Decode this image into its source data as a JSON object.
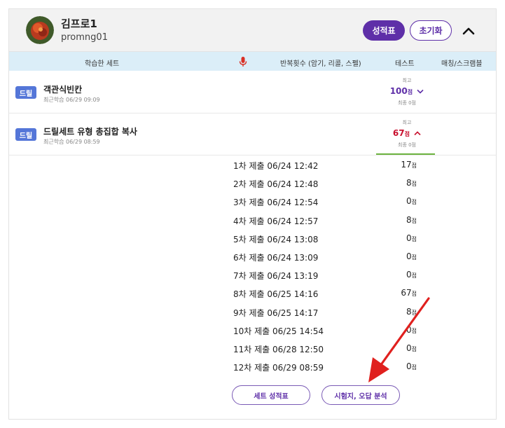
{
  "user": {
    "name": "김프로1",
    "id": "promng01"
  },
  "buttons": {
    "report": "성적표",
    "reset": "초기화",
    "set_report": "세트 성적표",
    "exam_analysis": "시험지, 오답 분석"
  },
  "columns": {
    "set": "학습한 세트",
    "repeat": "반복횟수 (암기, 리콜, 스펠)",
    "test": "테스트",
    "match": "매칭/스크램블"
  },
  "icons": {
    "mic": "microphone-icon",
    "collapse": "chevron-up-icon",
    "expand": "chevron-down-icon",
    "mic_color": "#d93025"
  },
  "sets": [
    {
      "badge": "드릴",
      "title": "객관식빈칸",
      "date": "최근학습 06/29 09:09",
      "best_label": "최고",
      "score": "100",
      "score_unit": "점",
      "final": "최종 0점",
      "color": "#5e2fa8"
    },
    {
      "badge": "드릴",
      "title": "드릴세트 유형 총집합 복사",
      "date": "최근학습 06/29 08:59",
      "best_label": "최고",
      "score": "67",
      "score_unit": "점",
      "final": "최종 0점",
      "color": "#c8102e"
    }
  ],
  "attempts": [
    {
      "label": "1차 제출 06/24 12:42",
      "score": "17",
      "unit": "점"
    },
    {
      "label": "2차 제출 06/24 12:48",
      "score": "8",
      "unit": "점"
    },
    {
      "label": "3차 제출 06/24 12:54",
      "score": "0",
      "unit": "점"
    },
    {
      "label": "4차 제출 06/24 12:57",
      "score": "8",
      "unit": "점"
    },
    {
      "label": "5차 제출 06/24 13:08",
      "score": "0",
      "unit": "점"
    },
    {
      "label": "6차 제출 06/24 13:09",
      "score": "0",
      "unit": "점"
    },
    {
      "label": "7차 제출 06/24 13:19",
      "score": "0",
      "unit": "점"
    },
    {
      "label": "8차 제출 06/25 14:16",
      "score": "67",
      "unit": "점"
    },
    {
      "label": "9차 제출 06/25 14:17",
      "score": "8",
      "unit": "점"
    },
    {
      "label": "10차 제출 06/25 14:54",
      "score": "0",
      "unit": "점"
    },
    {
      "label": "11차 제출 06/28 12:50",
      "score": "0",
      "unit": "점"
    },
    {
      "label": "12차 제출 06/29 08:59",
      "score": "0",
      "unit": "점"
    }
  ],
  "colors": {
    "accent": "#5e2fa8",
    "badge": "#5476d8",
    "header_bg": "#dbeef8",
    "annotation_arrow": "#e0201e"
  }
}
